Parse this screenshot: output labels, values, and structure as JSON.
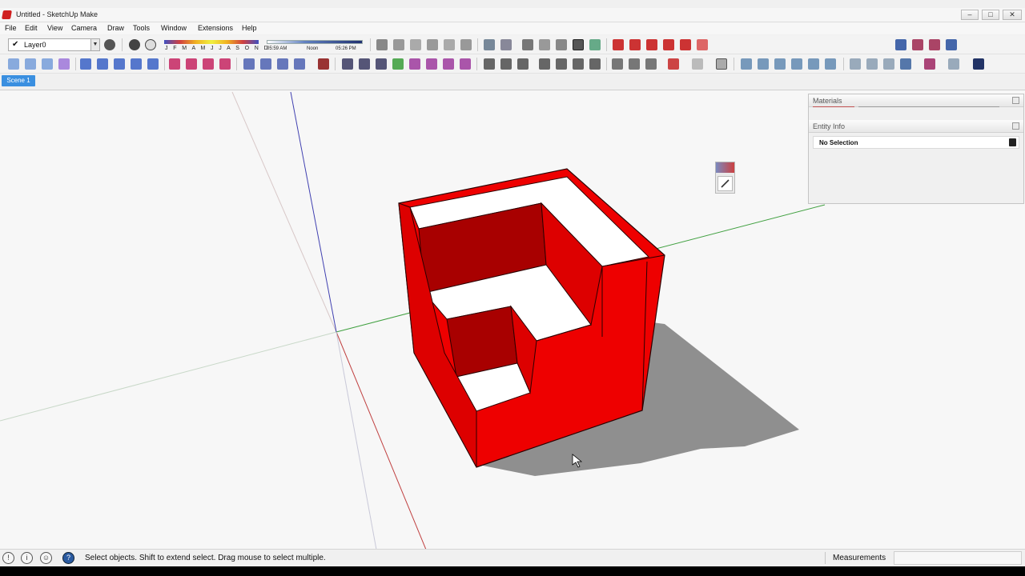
{
  "window": {
    "title": "Untitled - SketchUp Make",
    "controls": [
      "minimize-icon",
      "maximize-icon",
      "close-icon"
    ]
  },
  "menu": {
    "items": [
      "File",
      "Edit",
      "View",
      "Camera",
      "Draw",
      "Tools",
      "Window",
      "Extensions",
      "Help"
    ]
  },
  "layers": {
    "current": "Layer0"
  },
  "shadows": {
    "months": "J F M A M J J A S O N D",
    "time_start": "05:59 AM",
    "time_noon": "Noon",
    "time_end": "05:26 PM"
  },
  "scenes": {
    "tabs": [
      "Scene 1"
    ]
  },
  "trays": {
    "materials_title": "Materials",
    "entity_info_title": "Entity Info",
    "selection": "No Selection"
  },
  "status": {
    "hint": "Select objects. Shift to extend select. Drag mouse to select multiple.",
    "measurements_label": "Measurements",
    "measurements_value": ""
  },
  "colors": {
    "model_face": "#ee0000",
    "model_shade": "#a80000",
    "axis_red": "#c04040",
    "axis_green": "#40a040",
    "axis_blue": "#4040b0",
    "scene_tab": "#3a8fe0"
  }
}
